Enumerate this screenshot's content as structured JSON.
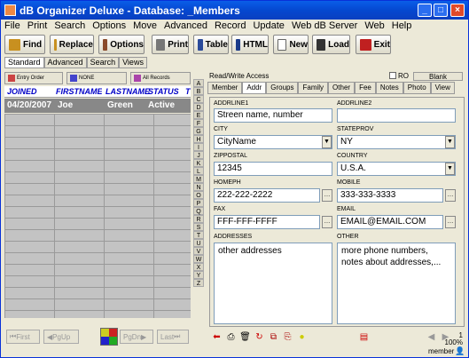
{
  "window": {
    "title": "dB Organizer Deluxe - Database: _Members"
  },
  "menu": [
    "File",
    "Print",
    "Search",
    "Options",
    "Move",
    "Advanced",
    "Record",
    "Update",
    "Web dB Server",
    "Web",
    "Help"
  ],
  "toolbar": {
    "find": "Find",
    "replace": "Replace",
    "options": "Options",
    "print": "Print",
    "table": "Table",
    "html": "HTML",
    "new": "New",
    "load": "Load",
    "exit": "Exit"
  },
  "mode_tabs": [
    "Standard",
    "Advanced",
    "Search",
    "Views"
  ],
  "left": {
    "entry_order": "Entry Order",
    "none": "NONE",
    "all_records": "All Records",
    "columns": [
      "JOINED",
      "FIRSTNAME",
      "LASTNAME",
      "STATUS",
      "T"
    ],
    "row": [
      "04/20/2007",
      "Joe",
      "Green",
      "Active"
    ],
    "nav": {
      "first": "First",
      "pgup": "PgUp",
      "pgdn": "PgDn",
      "last": "Last"
    }
  },
  "alpha": [
    "A",
    "B",
    "C",
    "D",
    "E",
    "F",
    "G",
    "H",
    "I",
    "J",
    "K",
    "L",
    "M",
    "N",
    "O",
    "P",
    "Q",
    "R",
    "S",
    "T",
    "U",
    "V",
    "W",
    "X",
    "Y",
    "Z"
  ],
  "right": {
    "rw": "Read/Write Access",
    "ro": "RO",
    "blank": "Blank",
    "tabs": [
      "Member",
      "Addr",
      "Groups",
      "Family",
      "Other",
      "Fee",
      "Notes",
      "Photo",
      "View"
    ],
    "fields": {
      "addrline1": {
        "label": "ADDRLINE1",
        "value": "Streen name, number"
      },
      "addrline2": {
        "label": "ADDRLINE2",
        "value": ""
      },
      "city": {
        "label": "CITY",
        "value": "CityName"
      },
      "stateprov": {
        "label": "STATEPROV",
        "value": "NY"
      },
      "zippostal": {
        "label": "ZIPPOSTAL",
        "value": "12345"
      },
      "country": {
        "label": "COUNTRY",
        "value": "U.S.A."
      },
      "homeph": {
        "label": "HOMEPH",
        "value": "222-222-2222"
      },
      "mobile": {
        "label": "MOBILE",
        "value": "333-333-3333"
      },
      "fax": {
        "label": "FAX",
        "value": "FFF-FFF-FFFF"
      },
      "email": {
        "label": "EMAIL",
        "value": "EMAIL@EMAIL.COM"
      },
      "addresses": {
        "label": "ADDRESSES",
        "value": "other addresses"
      },
      "other": {
        "label": "OTHER",
        "value": "more phone numbers, notes about addresses,..."
      }
    }
  },
  "status": {
    "count": "1",
    "zoom": "100%",
    "user": "member"
  }
}
